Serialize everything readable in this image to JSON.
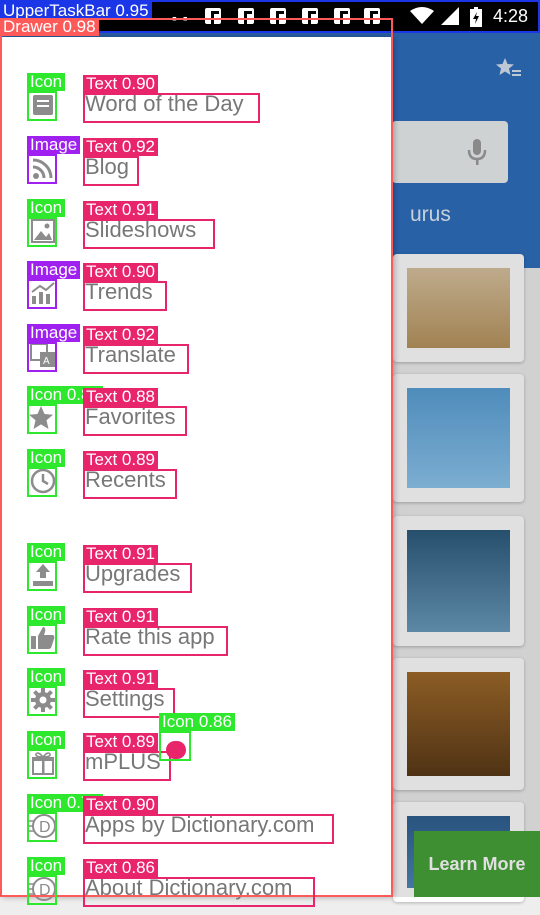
{
  "status_bar": {
    "time": "4:28",
    "notification_count": 6,
    "icons": [
      "facebook-notification-icon",
      "wifi-icon",
      "signal-icon",
      "battery-charging-icon"
    ]
  },
  "background_app": {
    "header_color": "#2f6fbf",
    "tab_partial_text": "urus",
    "learn_more_label": "Learn More"
  },
  "drawer": {
    "items": [
      {
        "label": "Word of the Day",
        "icon": "book-icon"
      },
      {
        "label": "Blog",
        "icon": "rss-icon"
      },
      {
        "label": "Slideshows",
        "icon": "image-icon"
      },
      {
        "label": "Trends",
        "icon": "chart-icon"
      },
      {
        "label": "Translate",
        "icon": "translate-icon"
      },
      {
        "label": "Favorites",
        "icon": "star-icon"
      },
      {
        "label": "Recents",
        "icon": "clock-icon"
      },
      {
        "label": "Upgrades",
        "icon": "upload-icon"
      },
      {
        "label": "Rate this app",
        "icon": "thumbs-up-icon"
      },
      {
        "label": "Settings",
        "icon": "gear-icon"
      },
      {
        "label": "mPLUS",
        "icon": "gift-icon"
      },
      {
        "label": "Apps by Dictionary.com",
        "icon": "dictionary-logo-icon"
      },
      {
        "label": "About Dictionary.com",
        "icon": "dictionary-logo-icon"
      }
    ]
  },
  "detections": {
    "status_bar": "UpperTaskBar 0.95",
    "drawer": "Drawer 0.98",
    "items": [
      {
        "icon": "Icon",
        "text": "Text 0.90"
      },
      {
        "icon": "Image",
        "text": "Text 0.92"
      },
      {
        "icon": "Icon",
        "text": "Text 0.91"
      },
      {
        "icon": "Image",
        "text": "Text 0.90"
      },
      {
        "icon": "Image",
        "text": "Text 0.92"
      },
      {
        "icon": "Icon 0.85",
        "text": "Text 0.88"
      },
      {
        "icon": "Icon",
        "text": "Text 0.89"
      },
      {
        "icon": "Icon",
        "text": "Text 0.91"
      },
      {
        "icon": "Icon",
        "text": "Text 0.91"
      },
      {
        "icon": "Icon",
        "text": "Text 0.91"
      },
      {
        "icon": "Icon",
        "text": "Text 0.89"
      },
      {
        "icon": "Icon 0.75",
        "text": "Text 0.90"
      },
      {
        "icon": "Icon",
        "text": "Text 0.86"
      }
    ],
    "extra_icon": "Icon 0.86"
  },
  "colors": {
    "text_box": "#e8246b",
    "icon_box": "#2ee82e",
    "image_box": "#a020f0",
    "drawer_box": "#ff5a5a",
    "taskbar_box": "#1a36e6"
  }
}
